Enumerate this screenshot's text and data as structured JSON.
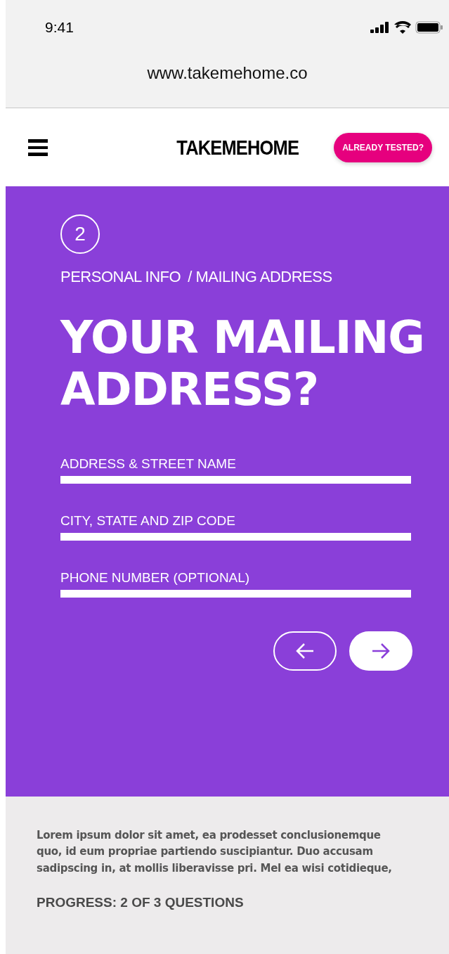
{
  "status_bar": {
    "time": "9:41"
  },
  "browser": {
    "url": "www.takemehome.co"
  },
  "header": {
    "logo": "TAKEMEHOME",
    "cta": "ALREADY TESTED?"
  },
  "step": {
    "number": "2",
    "breadcrumb": [
      "PERSONAL INFO",
      "/ MAILING ADDRESS"
    ]
  },
  "heading": "YOUR MAILING ADDRESS?",
  "fields": [
    {
      "label": "ADDRESS & STREET NAME"
    },
    {
      "label": "CITY, STATE AND ZIP CODE"
    },
    {
      "label": "PHONE NUMBER (OPTIONAL)"
    }
  ],
  "footer": {
    "text": "Lorem ipsum dolor sit amet, ea prodesset conclusionemque quo, id eum propriae partiendo suscipiantur. Duo accusam sadipscing in, at mollis liberavisse pri. Mel ea wisi cotidieque,",
    "progress": "PROGRESS: 2 OF 3 QUESTIONS"
  }
}
